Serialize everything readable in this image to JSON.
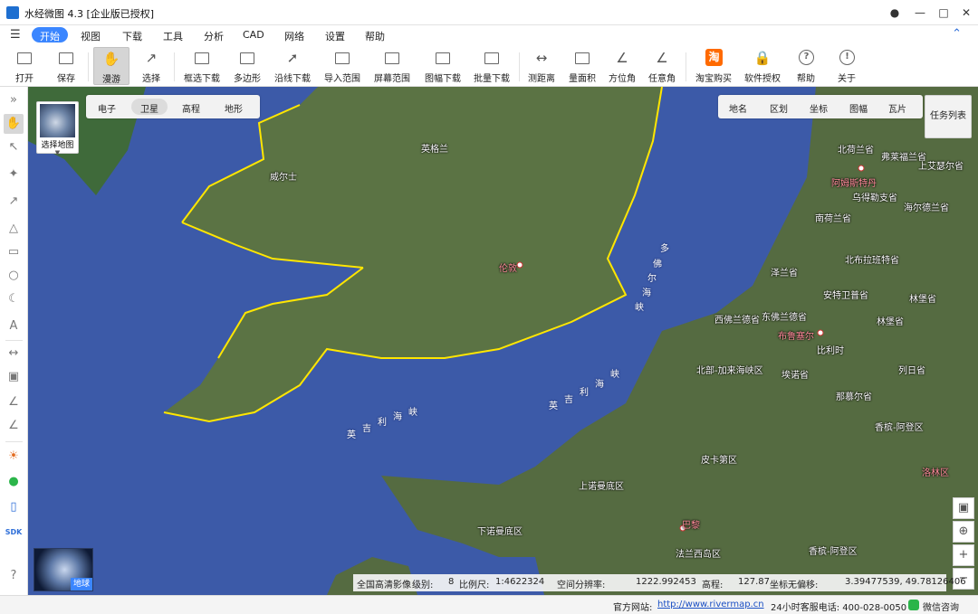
{
  "app": {
    "title": "水经微图 4.3 [企业版已授权]"
  },
  "menu": {
    "items": [
      "开始",
      "视图",
      "下载",
      "工具",
      "分析",
      "CAD",
      "网络",
      "设置",
      "帮助"
    ]
  },
  "toolbar": {
    "tools": [
      {
        "label": "打开",
        "icon": "folder-open-icon",
        "dropdown": true
      },
      {
        "label": "保存",
        "icon": "save-icon"
      },
      {
        "label": "漫游",
        "icon": "hand-pan-icon",
        "pressed": true
      },
      {
        "label": "选择",
        "icon": "select-cursor-icon"
      },
      {
        "label": "框选下载",
        "icon": "box-download-icon"
      },
      {
        "label": "多边形",
        "icon": "polygon-download-icon"
      },
      {
        "label": "沿线下载",
        "icon": "line-download-icon"
      },
      {
        "label": "导入范围",
        "icon": "import-range-icon"
      },
      {
        "label": "屏幕范围",
        "icon": "screen-range-icon"
      },
      {
        "label": "图幅下载",
        "icon": "sheet-download-icon",
        "dropdown": true
      },
      {
        "label": "批量下载",
        "icon": "batch-download-icon"
      },
      {
        "label": "测距离",
        "icon": "measure-distance-icon"
      },
      {
        "label": "量面积",
        "icon": "measure-area-icon"
      },
      {
        "label": "方位角",
        "icon": "azimuth-icon"
      },
      {
        "label": "任意角",
        "icon": "any-angle-icon"
      },
      {
        "label": "淘宝购买",
        "icon": "taobao-icon"
      },
      {
        "label": "软件授权",
        "icon": "lock-icon"
      },
      {
        "label": "帮助",
        "icon": "help-icon"
      },
      {
        "label": "关于",
        "icon": "about-icon"
      }
    ]
  },
  "map": {
    "basemap_label": "选择地图",
    "tabs": [
      "电子",
      "卫星",
      "高程",
      "地形"
    ],
    "active_tab": "卫星",
    "overlay_buttons": [
      "地名",
      "区划",
      "坐标",
      "图幅",
      "瓦片"
    ],
    "task_list": "任务列表",
    "globe_label": "地球",
    "labels": [
      "英格兰",
      "威尔士",
      "伦敦",
      "多",
      "佛",
      "尔",
      "海",
      "峡",
      "英",
      "吉",
      "利",
      "海",
      "峡",
      "英",
      "吉",
      "利",
      "海",
      "峡",
      "北荷兰省",
      "弗莱福兰省",
      "上艾瑟尔省",
      "阿姆斯特丹",
      "乌得勒支省",
      "南荷兰省",
      "海尔德兰省",
      "北布拉班特省",
      "泽兰省",
      "安特卫普省",
      "林堡省",
      "西佛兰德省",
      "东佛兰德省",
      "布鲁塞尔",
      "比利时",
      "林堡省",
      "北部-加来海峡区",
      "埃诺省",
      "那慕尔省",
      "列日省",
      "皮卡第区",
      "香槟-阿登区",
      "上诺曼底区",
      "下诺曼底区",
      "巴黎",
      "法兰西岛区",
      "香槟-阿登区",
      "洛林区"
    ],
    "status": {
      "source": "全国高清影像",
      "level_label": "级别:",
      "level": "8",
      "scale_label": "比例尺:",
      "scale": "1:4622324",
      "resolution_label": "空间分辨率:",
      "resolution": "1222.992453",
      "elevation_label": "高程:",
      "elevation": "127.87",
      "coord_label": "坐标无偏移:",
      "coords": "3.39477539, 49.78126406"
    }
  },
  "footer": {
    "website_label": "官方网站:",
    "website": "http://www.rivermap.cn",
    "hotline": "24小时客服电话: 400-028-0050",
    "wechat": "微信咨询"
  },
  "colors": {
    "accent": "#3b86ff",
    "sea": "#3c5aa8",
    "boundary": "#ffe600",
    "taobao": "#ff6a00"
  }
}
